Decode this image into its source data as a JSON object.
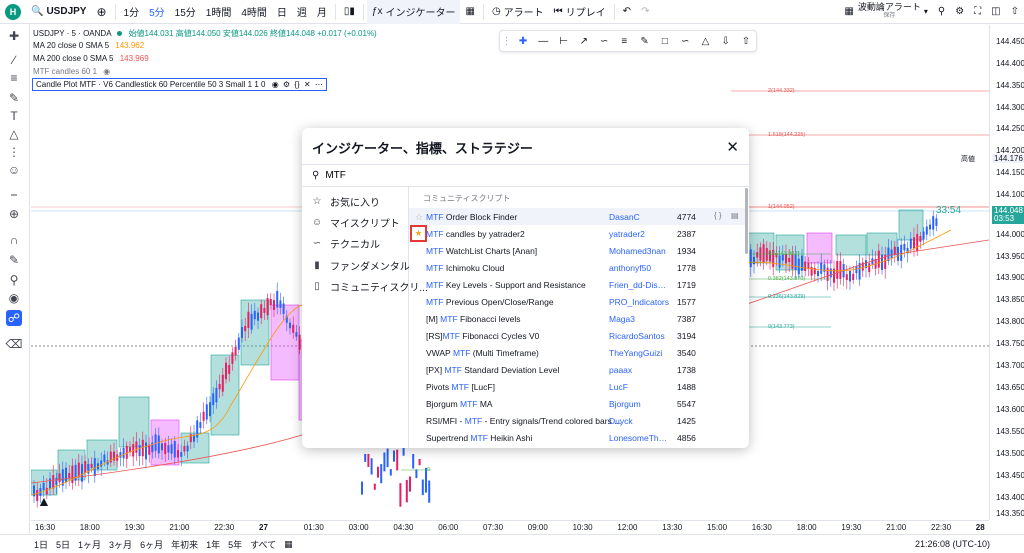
{
  "topbar": {
    "logo_text": "H",
    "symbol": "USDJPY",
    "intervals": [
      "1分",
      "5分",
      "15分",
      "1時間",
      "4時間",
      "日",
      "週",
      "月"
    ],
    "active_interval": "5分",
    "indicators_label": "インジケーター",
    "alert_label": "アラート",
    "replay_label": "リプレイ",
    "layout_name": "波動論アラート",
    "layout_sub": "保存"
  },
  "legend": {
    "title": "USDJPY · 5 · OANDA",
    "ohlc": "始値144.031 高値144.050 安値144.026 終値144.048 +0.017 (+0.01%)",
    "ma20": "MA 20 close 0 SMA 5",
    "ma20_value": "143.962",
    "ma200": "MA 200 close 0 SMA 5",
    "ma200_value": "143.969",
    "mtf_candles": "MTF candles 60 1",
    "candle_plot": "Candle Plot MTF · V6 Candlestick 60 Percentile 50 3 Small 1 1 0"
  },
  "price_scale": [
    "144.450",
    "144.400",
    "144.350",
    "144.300",
    "144.250",
    "144.200",
    "144.176",
    "144.150",
    "144.100",
    "144.048",
    "144.000",
    "143.950",
    "143.900",
    "143.850",
    "143.800",
    "143.750",
    "143.700",
    "143.650",
    "143.600",
    "143.550",
    "143.500",
    "143.450",
    "143.400",
    "143.350"
  ],
  "price_scale_current": "144.048",
  "price_scale_countdown": "03:53",
  "high_label": "高値",
  "countdown_big": "33:54",
  "fib_labels": [
    "2(144.332)",
    "1.618(144.225)",
    "1(144.052)",
    "0.5(143.903)",
    "0.382(143.870)",
    "0.236(143.829)",
    "0(143.773)",
    "0"
  ],
  "time_axis": [
    "16:30",
    "18:00",
    "19:30",
    "21:00",
    "22:30",
    "27",
    "01:30",
    "03:00",
    "04:30",
    "06:00",
    "07:30",
    "09:00",
    "10:30",
    "12:00",
    "13:30",
    "15:00",
    "16:30",
    "18:00",
    "19:30",
    "21:00",
    "22:30",
    "28"
  ],
  "bottombar": {
    "ranges": [
      "1日",
      "5日",
      "1ヶ月",
      "3ヶ月",
      "6ヶ月",
      "年初来",
      "1年",
      "5年",
      "すべて"
    ],
    "time": "21:26:08 (UTC-10)"
  },
  "dialog": {
    "title": "インジケーター、指標、ストラテジー",
    "search_value": "MTF",
    "sidebar": [
      "お気に入り",
      "マイスクリプト",
      "テクニカル",
      "ファンダメンタル",
      "コミュニティスクリ..."
    ],
    "list_header": "コミュニティスクリプト",
    "rows": [
      {
        "prefix": "",
        "mtf": "MTF",
        "suffix": " Order Block Finder",
        "author": "DasanC",
        "likes": "4774"
      },
      {
        "prefix": "",
        "mtf": "MTF",
        "suffix": " candles by yatrader2",
        "author": "yatrader2",
        "likes": "2387"
      },
      {
        "prefix": "",
        "mtf": "MTF",
        "suffix": " WatchList Charts [Anan]",
        "author": "Mohamed3nan",
        "likes": "1934"
      },
      {
        "prefix": "",
        "mtf": "MTF",
        "suffix": " Ichimoku Cloud",
        "author": "anthonyf50",
        "likes": "1778"
      },
      {
        "prefix": "",
        "mtf": "MTF",
        "suffix": " Key Levels - Support and Resistance",
        "author": "Frien_dd-DisD...",
        "likes": "1719"
      },
      {
        "prefix": "",
        "mtf": "MTF",
        "suffix": " Previous Open/Close/Range",
        "author": "PRO_Indicators",
        "likes": "1577"
      },
      {
        "prefix": "[M] ",
        "mtf": "MTF",
        "suffix": " Fibonacci levels",
        "author": "Maga3",
        "likes": "7387"
      },
      {
        "prefix": "[RS]",
        "mtf": "MTF",
        "suffix": " Fibonacci Cycles V0",
        "author": "RicardoSantos",
        "likes": "3194"
      },
      {
        "prefix": "VWAP ",
        "mtf": "MTF",
        "suffix": " (Multi Timeframe)",
        "author": "TheYangGuizi",
        "likes": "3540"
      },
      {
        "prefix": "[PX] ",
        "mtf": "MTF",
        "suffix": " Standard Deviation Level",
        "author": "paaax",
        "likes": "1738"
      },
      {
        "prefix": "Pivots ",
        "mtf": "MTF",
        "suffix": " [LucF]",
        "author": "LucF",
        "likes": "1488"
      },
      {
        "prefix": "Bjorgum ",
        "mtf": "MTF",
        "suffix": " MA",
        "author": "Bjorgum",
        "likes": "5547"
      },
      {
        "prefix": "RSI/MFI - ",
        "mtf": "MTF",
        "suffix": " - Entry signals/Trend colored bars ...",
        "author": "Duyck",
        "likes": "1425"
      },
      {
        "prefix": "Supertrend ",
        "mtf": "MTF",
        "suffix": " Heikin Ashi",
        "author": "LonesomeThe...",
        "likes": "4856"
      }
    ]
  },
  "colors": {
    "accent": "#2962ff",
    "bull_box": "#26a69a",
    "bear_box": "#e040fb",
    "ma20": "#ff9800",
    "ma200": "#ef5350",
    "highlight_box": "#e53935",
    "star_gold": "#f9a825"
  }
}
